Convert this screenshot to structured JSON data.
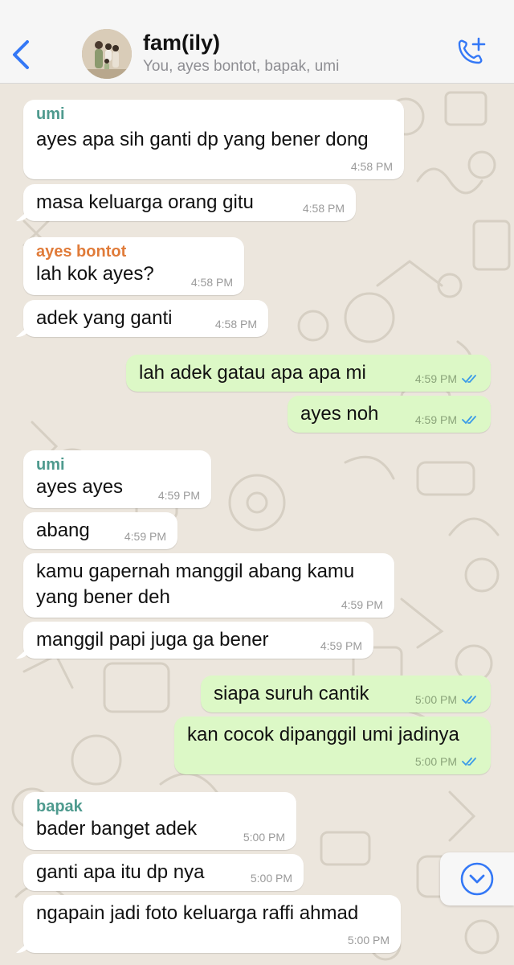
{
  "header": {
    "title": "fam(ily)",
    "subtitle": "You, ayes bontot, bapak, umi"
  },
  "colors": {
    "accent": "#3478f6",
    "incoming_bubble": "#ffffff",
    "outgoing_bubble": "#dcf8c6",
    "sender_umi": "#4e9a8e",
    "sender_ayes": "#e07b39",
    "sender_bapak": "#4e9a8e",
    "read_ticks": "#3b9be8"
  },
  "messages": [
    {
      "sender": "umi",
      "text": "ayes apa sih ganti dp yang bener dong",
      "time": "4:58 PM"
    },
    {
      "text": "masa keluarga orang gitu",
      "time": "4:58 PM"
    },
    {
      "sender": "ayes bontot",
      "text": "lah kok ayes?",
      "time": "4:58 PM"
    },
    {
      "text": "adek yang ganti",
      "time": "4:58 PM"
    },
    {
      "text": "lah adek gatau apa apa mi",
      "time": "4:59 PM",
      "status": "read"
    },
    {
      "text": "ayes noh",
      "time": "4:59 PM",
      "status": "read"
    },
    {
      "sender": "umi",
      "text": "ayes ayes",
      "time": "4:59 PM"
    },
    {
      "text": "abang",
      "time": "4:59 PM"
    },
    {
      "text_lines": [
        "kamu gapernah manggil abang kamu",
        "yang bener deh"
      ],
      "time": "4:59 PM"
    },
    {
      "text": "manggil papi juga ga bener",
      "time": "4:59 PM"
    },
    {
      "text": "siapa suruh cantik",
      "time": "5:00 PM",
      "status": "read"
    },
    {
      "text": "kan cocok dipanggil umi jadinya",
      "time": "5:00 PM",
      "status": "read"
    },
    {
      "sender": "bapak",
      "text": "bader banget adek",
      "time": "5:00 PM"
    },
    {
      "text": "ganti apa itu dp nya",
      "time": "5:00 PM"
    },
    {
      "text": "ngapain jadi foto keluarga raffi ahmad",
      "time": "5:00 PM"
    }
  ]
}
